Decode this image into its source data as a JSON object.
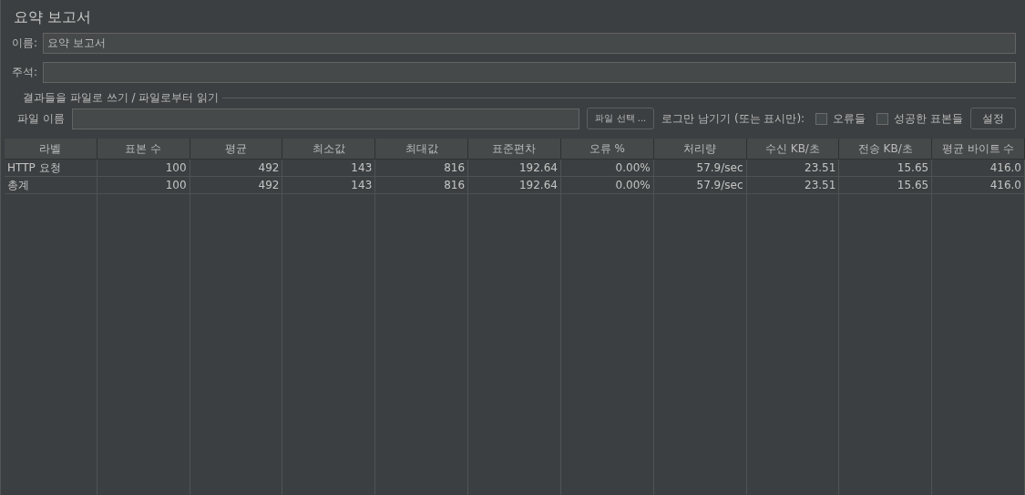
{
  "title": "요약 보고서",
  "name_field": {
    "label": "이름:",
    "value": "요약 보고서"
  },
  "comment_field": {
    "label": "주석:"
  },
  "file_group": {
    "title": "결과들을 파일로 쓰기 / 파일로부터 읽기",
    "filename_label": "파일 이름",
    "browse_button": "파일 선택 ...",
    "log_only_label": "로그만 남기기 (또는 표시만):",
    "checkboxes": [
      {
        "label": "오류들",
        "checked": false
      },
      {
        "label": "성공한 표본들",
        "checked": false
      }
    ],
    "settings_button": "설정"
  },
  "table": {
    "columns": [
      "라벨",
      "표본 수",
      "평균",
      "최소값",
      "최대값",
      "표준편차",
      "오류 %",
      "처리량",
      "수신 KB/초",
      "전송 KB/초",
      "평균 바이트 수"
    ],
    "rows": [
      [
        "HTTP 요청",
        "100",
        "492",
        "143",
        "816",
        "192.64",
        "0.00%",
        "57.9/sec",
        "23.51",
        "15.65",
        "416.0"
      ],
      [
        "총계",
        "100",
        "492",
        "143",
        "816",
        "192.64",
        "0.00%",
        "57.9/sec",
        "23.51",
        "15.65",
        "416.0"
      ]
    ]
  }
}
